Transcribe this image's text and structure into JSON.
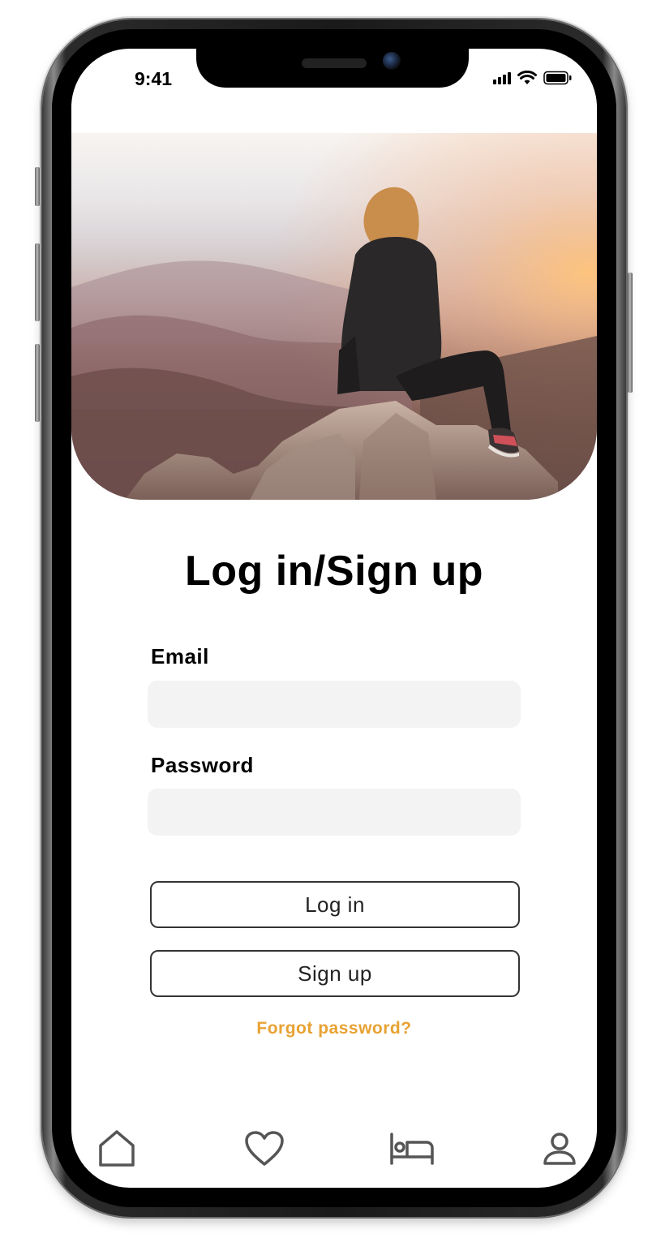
{
  "status_bar": {
    "time": "9:41",
    "icons": [
      "cellular-signal-icon",
      "wifi-icon",
      "battery-icon"
    ]
  },
  "hero": {
    "image_description_icon": "hero-photo"
  },
  "form": {
    "title": "Log in/Sign up",
    "email_label": "Email",
    "email_value": "",
    "password_label": "Password",
    "password_value": "",
    "login_label": "Log in",
    "signup_label": "Sign up",
    "forgot_label": "Forgot password?"
  },
  "tab_bar": {
    "items": [
      {
        "icon": "home-icon"
      },
      {
        "icon": "heart-icon"
      },
      {
        "icon": "bed-icon"
      },
      {
        "icon": "user-icon"
      }
    ]
  },
  "colors": {
    "accent": "#e8a233",
    "input_bg": "#f3f3f3",
    "icon_gray": "#555555",
    "text": "#000000"
  }
}
